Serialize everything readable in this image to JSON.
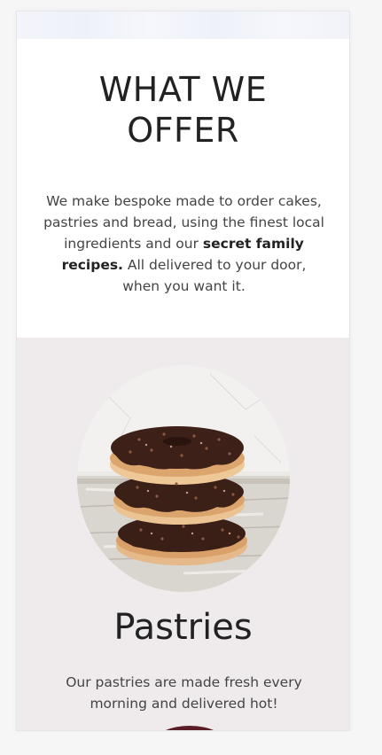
{
  "offer": {
    "heading_line1": "WHAT WE",
    "heading_line2": "OFFER",
    "text_part1": "We make bespoke made to order cakes, pastries and bread, using the finest local ingredients and our ",
    "text_bold1": "secret family recipes.",
    "text_part2": " All delivered to your door, when you want it."
  },
  "pastries": {
    "image": "stacked-chocolate-donuts",
    "title": "Pastries",
    "description": "Our pastries are made fresh every morning and delivered hot!"
  },
  "colors": {
    "section_bg": "#efebec",
    "heading": "#222222",
    "body_text": "#444444"
  }
}
